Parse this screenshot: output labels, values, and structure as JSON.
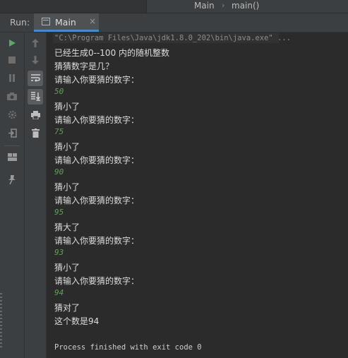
{
  "breadcrumb": {
    "class_name": "Main",
    "separator": "›",
    "method_name": "main()"
  },
  "run_panel": {
    "label": "Run:",
    "tab_label": "Main",
    "tab_close": "×"
  },
  "toolbar_icons": {
    "left": [
      "run-icon",
      "stop-icon",
      "pause-icon",
      "camera-icon",
      "settings-icon",
      "exit-icon",
      "layout-icon",
      "pin-icon"
    ],
    "right": [
      "up-arrow-icon",
      "down-arrow-icon",
      "soft-wrap-icon",
      "scroll-to-end-icon",
      "print-icon",
      "trash-icon"
    ]
  },
  "console": {
    "command": "\"C:\\Program Files\\Java\\jdk1.8.0_202\\bin\\java.exe\" ...",
    "lines": [
      {
        "text": "已经生成0--100 内的随机整数",
        "type": "output"
      },
      {
        "text": "猜猜数字是几？",
        "type": "output"
      },
      {
        "text": "请输入你要猜的数字：",
        "type": "output"
      },
      {
        "text": "50",
        "type": "input"
      },
      {
        "text": "猜小了",
        "type": "output"
      },
      {
        "text": "请输入你要猜的数字：",
        "type": "output"
      },
      {
        "text": "75",
        "type": "input"
      },
      {
        "text": "猜小了",
        "type": "output"
      },
      {
        "text": "请输入你要猜的数字：",
        "type": "output"
      },
      {
        "text": "90",
        "type": "input"
      },
      {
        "text": "猜小了",
        "type": "output"
      },
      {
        "text": "请输入你要猜的数字：",
        "type": "output"
      },
      {
        "text": "95",
        "type": "input"
      },
      {
        "text": "猜大了",
        "type": "output"
      },
      {
        "text": "请输入你要猜的数字：",
        "type": "output"
      },
      {
        "text": "93",
        "type": "input"
      },
      {
        "text": "猜小了",
        "type": "output"
      },
      {
        "text": "请输入你要猜的数字：",
        "type": "output"
      },
      {
        "text": "94",
        "type": "input"
      },
      {
        "text": "猜对了",
        "type": "output"
      },
      {
        "text": "这个数是94",
        "type": "output"
      },
      {
        "text": "",
        "type": "blank"
      },
      {
        "text": "Process finished with exit code 0",
        "type": "mono"
      }
    ]
  }
}
